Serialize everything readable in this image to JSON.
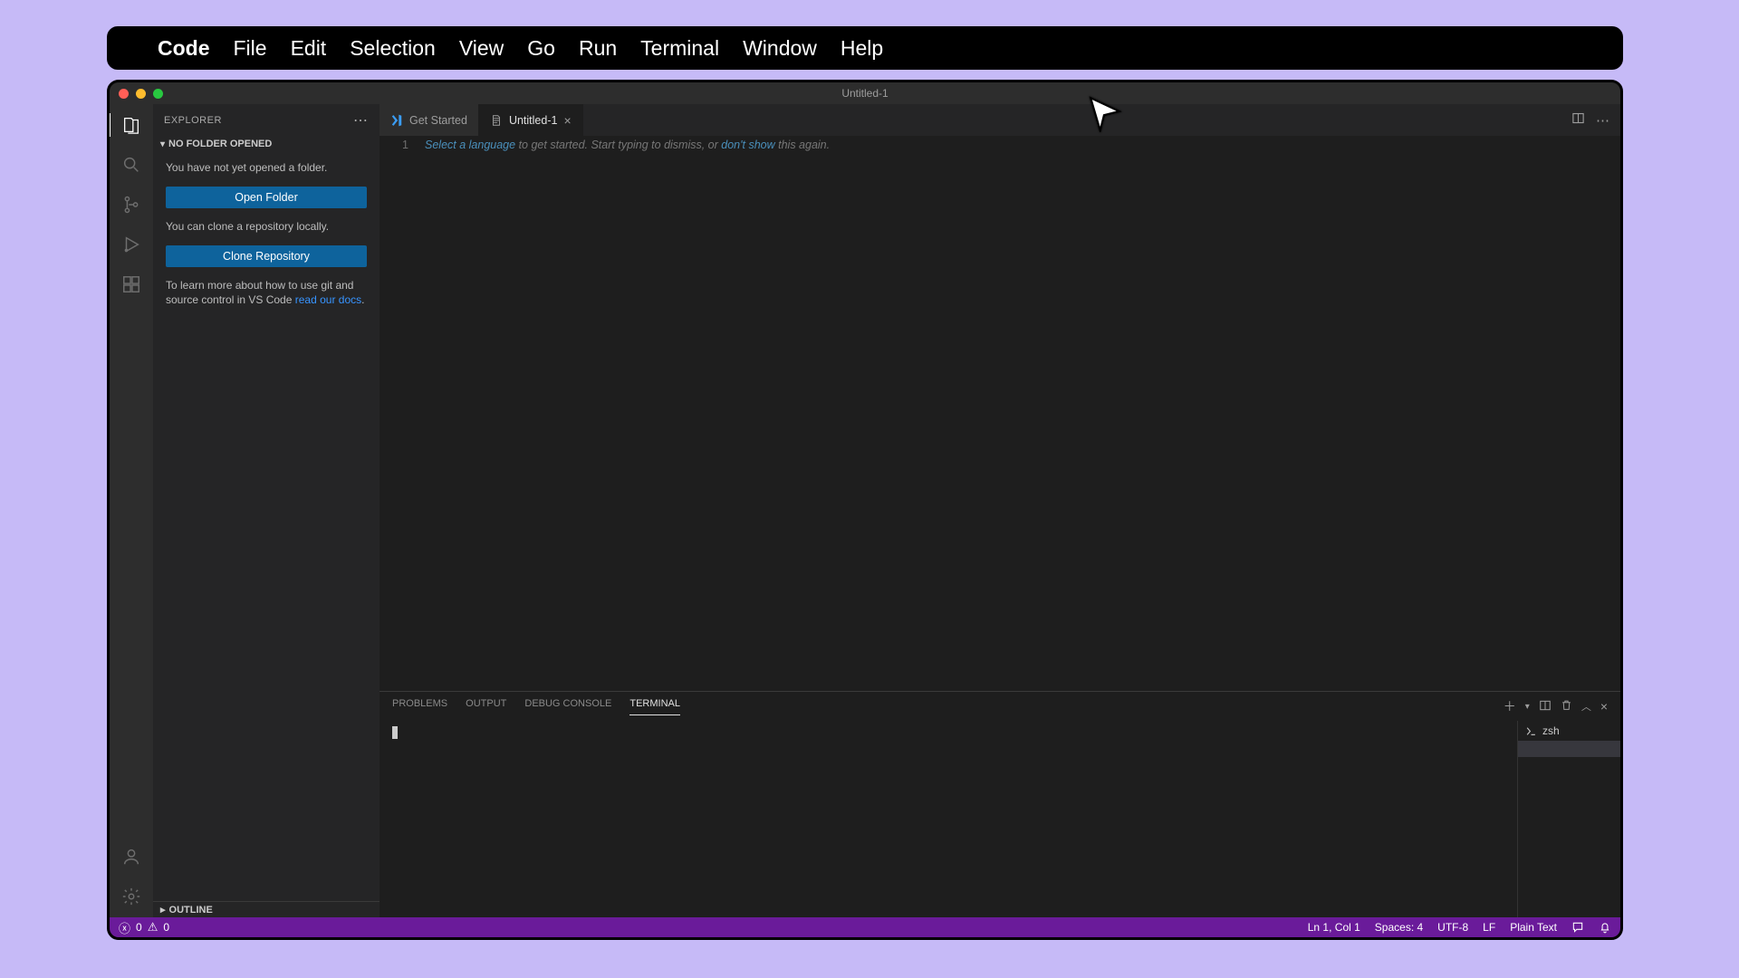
{
  "menubar": {
    "app": "Code",
    "items": [
      "File",
      "Edit",
      "Selection",
      "View",
      "Go",
      "Run",
      "Terminal",
      "Window",
      "Help"
    ]
  },
  "window": {
    "title": "Untitled-1"
  },
  "sidebar": {
    "title": "EXPLORER",
    "section": "NO FOLDER OPENED",
    "msg_no_folder": "You have not yet opened a folder.",
    "btn_open": "Open Folder",
    "msg_clone": "You can clone a repository locally.",
    "btn_clone": "Clone Repository",
    "msg_docs_a": "To learn more about how to use git and source control in VS Code ",
    "msg_docs_link": "read our docs",
    "msg_docs_b": ".",
    "outline": "OUTLINE"
  },
  "tabs": {
    "get_started": "Get Started",
    "untitled": "Untitled-1"
  },
  "editor": {
    "line_no": "1",
    "seg_select": "Select a language",
    "seg_mid": " to get started. Start typing to dismiss, or ",
    "seg_link": "don't show",
    "seg_end": " this again."
  },
  "panel": {
    "problems": "PROBLEMS",
    "output": "OUTPUT",
    "debug": "DEBUG CONSOLE",
    "terminal": "TERMINAL",
    "shell": "zsh"
  },
  "status": {
    "errors": "0",
    "warnings": "0",
    "pos": "Ln 1, Col 1",
    "spaces": "Spaces: 4",
    "enc": "UTF-8",
    "eol": "LF",
    "lang": "Plain Text"
  }
}
